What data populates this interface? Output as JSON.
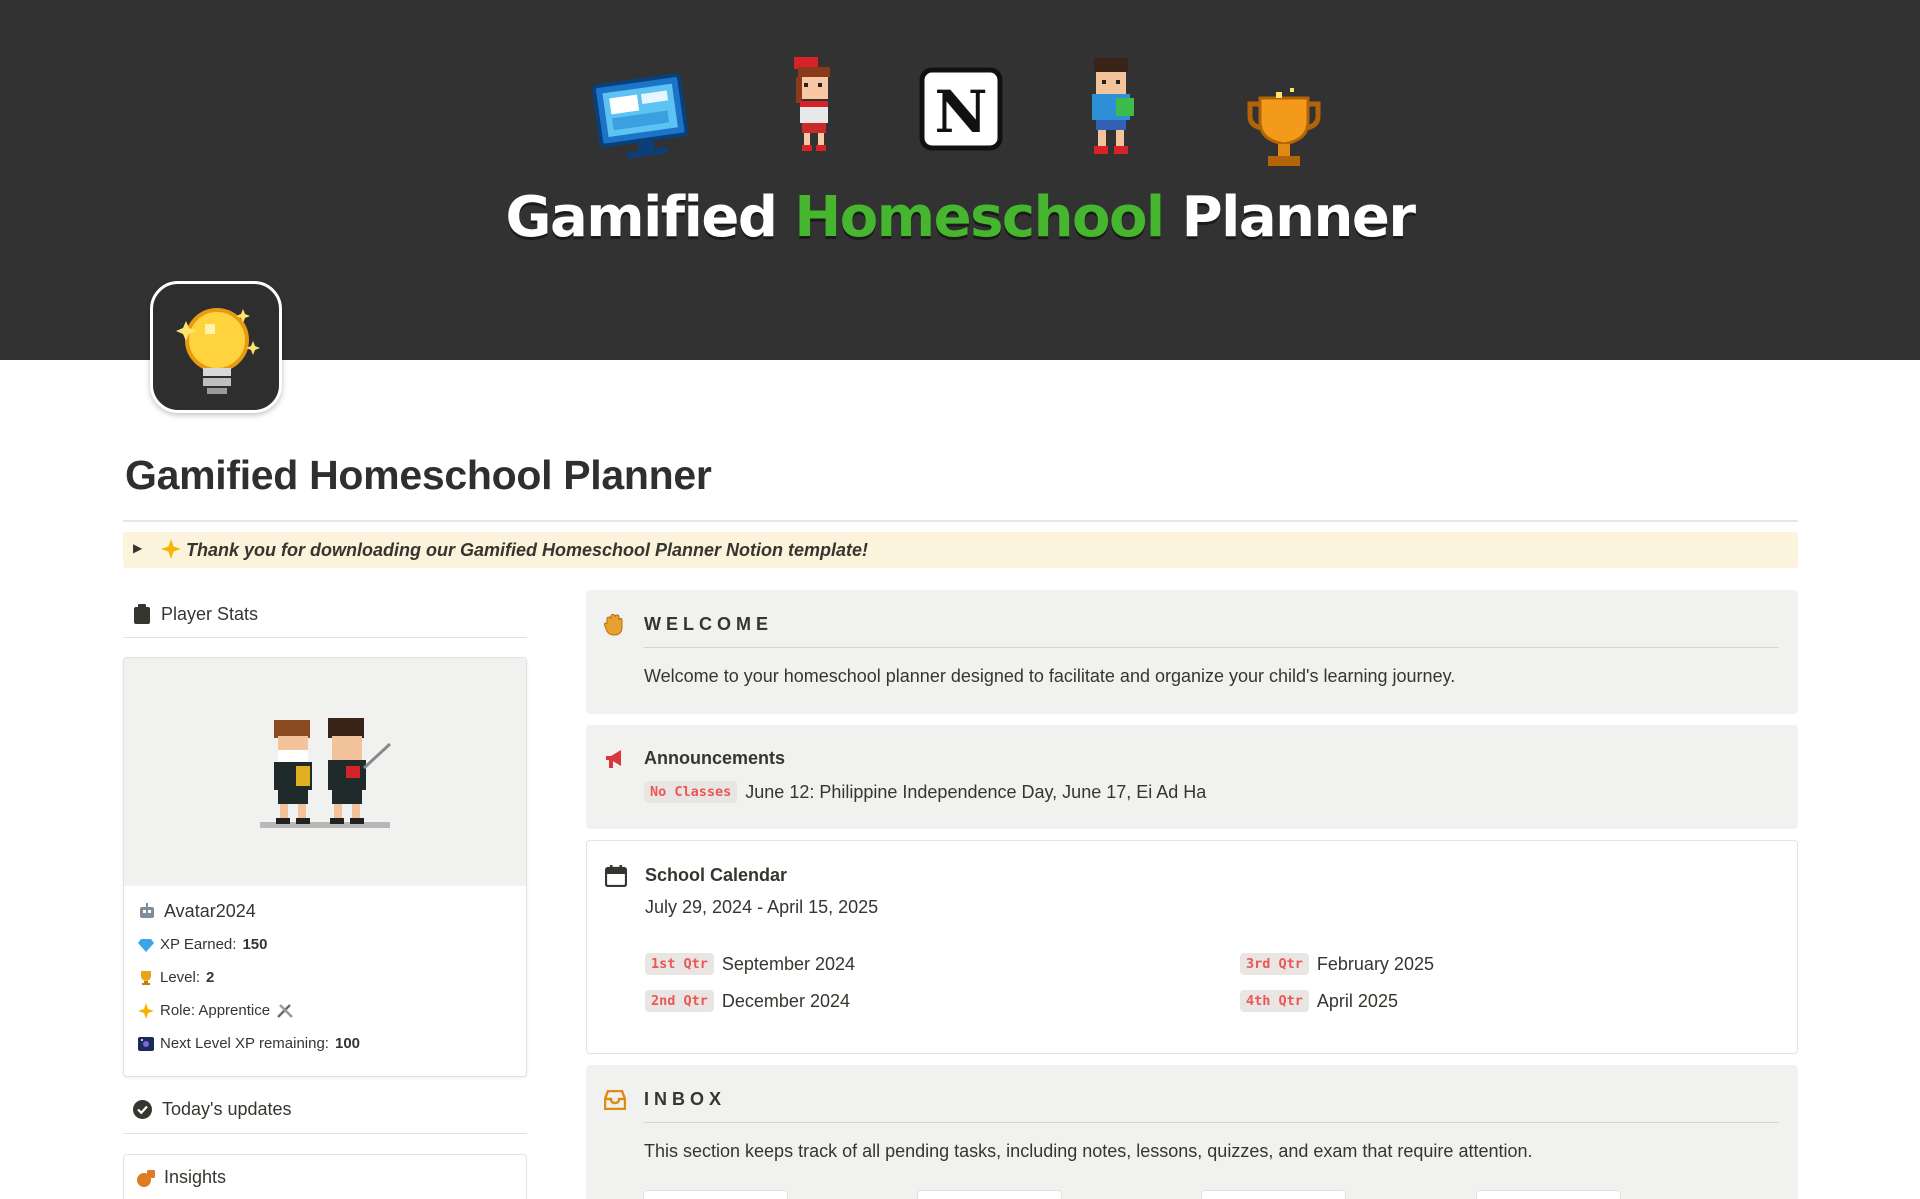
{
  "cover": {
    "title_white_1": "Gamified",
    "title_green": "Homeschool",
    "title_white_2": "Planner",
    "sprites": [
      "computer-monitor-icon",
      "girl-character-icon",
      "notion-logo-icon",
      "boy-character-icon",
      "trophy-icon"
    ]
  },
  "page": {
    "icon": "lightbulb-icon",
    "title": "Gamified Homeschool Planner"
  },
  "callout": {
    "text": "Thank you for downloading our Gamified Homeschool Planner Notion template!"
  },
  "player_stats": {
    "heading": "Player Stats",
    "avatar_name": "Avatar2024",
    "stats": [
      {
        "label": "XP Earned:",
        "value": "150",
        "icon": "gem-icon"
      },
      {
        "label": "Level:",
        "value": "2",
        "icon": "trophy-icon"
      },
      {
        "label": "Role: Apprentice",
        "value": "",
        "icon": "star-icon"
      },
      {
        "label": "Next Level XP remaining:",
        "value": "100",
        "icon": "galaxy-icon"
      }
    ]
  },
  "todays_updates": {
    "heading": "Today's updates"
  },
  "insights": {
    "heading": "Insights"
  },
  "welcome": {
    "heading": "WELCOME",
    "text": "Welcome to your homeschool planner designed to facilitate and organize your child's learning journey."
  },
  "announcements": {
    "heading": "Announcements",
    "tag": "No Classes",
    "text": "June 12: Philippine Independence Day, June 17, Ei Ad Ha"
  },
  "calendar": {
    "heading": "School Calendar",
    "range": "July 29, 2024 - April 15, 2025",
    "quarters": [
      {
        "tag": "1st Qtr",
        "date": "September 2024"
      },
      {
        "tag": "2nd Qtr",
        "date": "December 2024"
      },
      {
        "tag": "3rd Qtr",
        "date": "February 2025"
      },
      {
        "tag": "4th Qtr",
        "date": "April 2025"
      }
    ]
  },
  "inbox": {
    "heading": "INBOX",
    "text": "This section keeps track of all pending tasks, including notes, lessons, quizzes, and exam that require attention."
  },
  "colors": {
    "cover_bg": "#323232",
    "accent_green": "#46b62f",
    "callout_bg": "#fbf3db",
    "gray_block": "#f1f1ef",
    "tag_red": "#eb5757"
  }
}
